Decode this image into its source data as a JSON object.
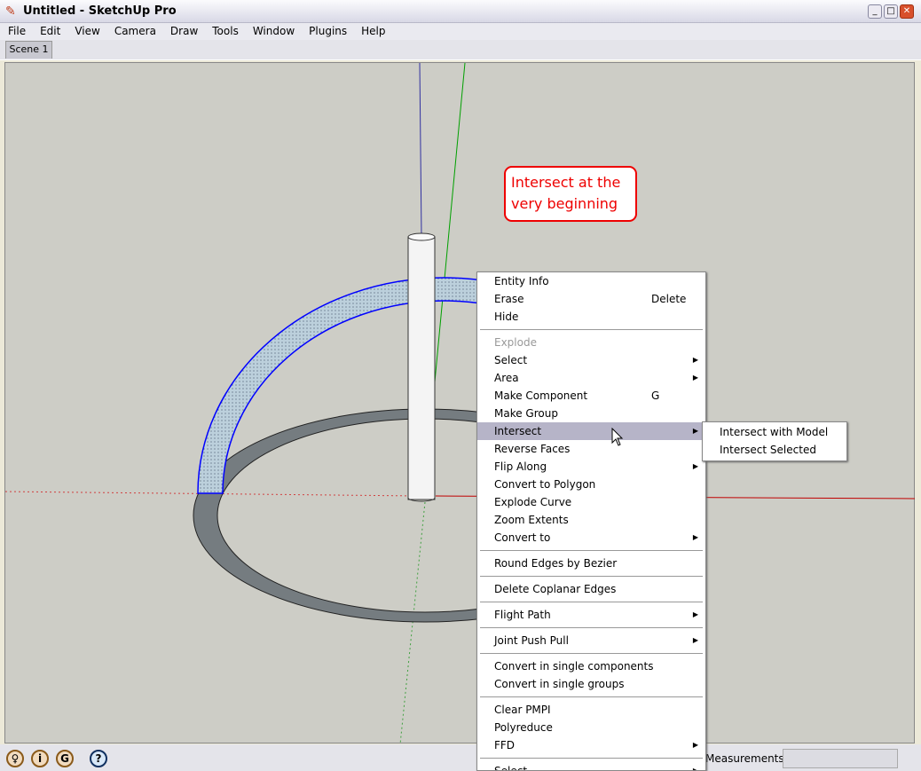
{
  "window": {
    "title": "Untitled - SketchUp Pro",
    "buttons": [
      "_",
      "□",
      "✕"
    ]
  },
  "menubar": [
    "File",
    "Edit",
    "View",
    "Camera",
    "Draw",
    "Tools",
    "Window",
    "Plugins",
    "Help"
  ],
  "scenes": [
    "Scene 1"
  ],
  "callout": {
    "text": "Intersect at the very beginning",
    "color": "#e00000"
  },
  "context_menu": {
    "groups": [
      [
        {
          "label": "Entity Info"
        },
        {
          "label": "Erase",
          "shortcut": "Delete"
        },
        {
          "label": "Hide"
        }
      ],
      [
        {
          "label": "Explode",
          "disabled": true
        },
        {
          "label": "Select",
          "submenu": true
        },
        {
          "label": "Area",
          "submenu": true
        },
        {
          "label": "Make Component",
          "shortcut": "G"
        },
        {
          "label": "Make Group"
        },
        {
          "label": "Intersect",
          "submenu": true,
          "highlighted": true
        },
        {
          "label": "Reverse Faces"
        },
        {
          "label": "Flip Along",
          "submenu": true
        },
        {
          "label": "Convert to Polygon"
        },
        {
          "label": "Explode Curve"
        },
        {
          "label": "Zoom Extents"
        },
        {
          "label": "Convert to",
          "submenu": true
        }
      ],
      [
        {
          "label": "Round Edges by Bezier"
        }
      ],
      [
        {
          "label": "Delete Coplanar Edges"
        }
      ],
      [
        {
          "label": "Flight Path",
          "submenu": true
        }
      ],
      [
        {
          "label": "Joint Push Pull",
          "submenu": true
        }
      ],
      [
        {
          "label": "Convert in single components"
        },
        {
          "label": "Convert in single groups"
        }
      ],
      [
        {
          "label": "Clear PMPI"
        },
        {
          "label": "Polyreduce"
        },
        {
          "label": "FFD",
          "submenu": true
        }
      ],
      [
        {
          "label": "Select",
          "submenu": true
        }
      ]
    ]
  },
  "submenu": [
    "Intersect with Model",
    "Intersect Selected"
  ],
  "statusbar": {
    "icons": [
      "geo-location-icon",
      "credits-icon",
      "google-icon",
      "help-icon"
    ],
    "measurements_label": "Measurements",
    "measurements_value": ""
  }
}
